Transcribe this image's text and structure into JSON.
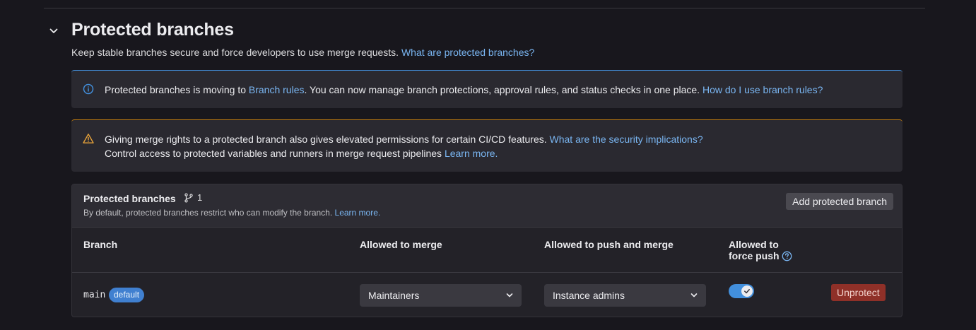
{
  "section": {
    "title": "Protected branches",
    "description": "Keep stable branches secure and force developers to use merge requests.",
    "description_link": "What are protected branches?"
  },
  "info_alert": {
    "text1": "Protected branches is moving to ",
    "link1": "Branch rules",
    "text2": ". You can now manage branch protections, approval rules, and status checks in one place. ",
    "link2": "How do I use branch rules?",
    "icon": "info-icon"
  },
  "warning_alert": {
    "line1": "Giving merge rights to a protected branch also gives elevated permissions for certain CI/CD features. ",
    "line1_link": "What are the security implications?",
    "line2": "Control access to protected variables and runners in merge request pipelines ",
    "line2_link": "Learn more.",
    "icon": "warning-icon"
  },
  "card": {
    "title": "Protected branches",
    "count": "1",
    "subtitle": "By default, protected branches restrict who can modify the branch. ",
    "subtitle_link": "Learn more.",
    "add_button": "Add protected branch"
  },
  "table": {
    "headers": {
      "branch": "Branch",
      "merge": "Allowed to merge",
      "push": "Allowed to push and merge",
      "force_line1": "Allowed to",
      "force_line2": "force push"
    },
    "rows": [
      {
        "branch": "main",
        "badge": "default",
        "merge": "Maintainers",
        "push": "Instance admins",
        "force_push": true,
        "action": "Unprotect"
      }
    ]
  },
  "colors": {
    "accent": "#428fdc",
    "link": "#7ab6f2",
    "danger": "#8f3028",
    "warning": "#c17d10"
  }
}
